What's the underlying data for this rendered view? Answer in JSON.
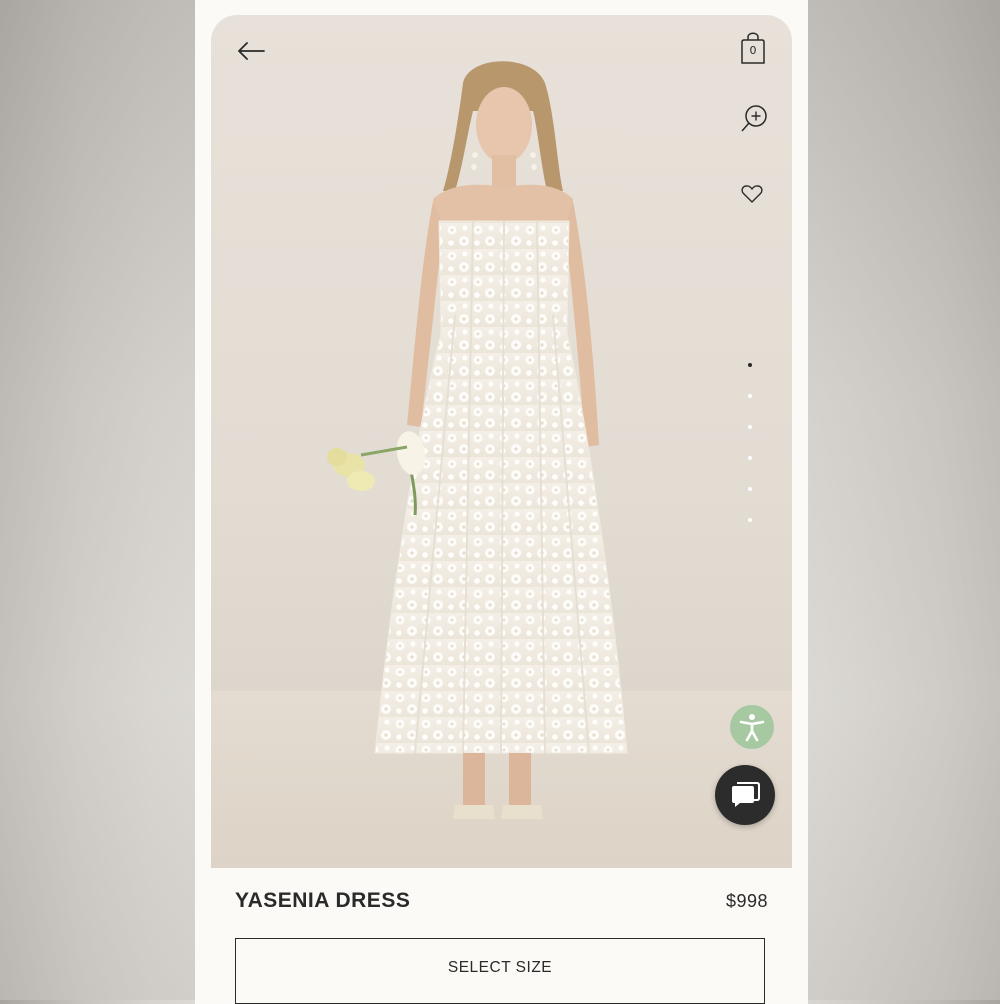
{
  "header": {
    "back_icon": "arrow-left-icon",
    "bag_icon": "shopping-bag-icon",
    "bag_count": "0",
    "zoom_icon": "zoom-in-icon",
    "wishlist_icon": "heart-icon"
  },
  "carousel": {
    "total_slides": 6,
    "active_index": 0
  },
  "floating": {
    "accessibility_icon": "accessibility-icon",
    "chat_icon": "chat-bubble-icon"
  },
  "product": {
    "name": "YASENIA DRESS",
    "price": "$998",
    "select_size_label": "SELECT SIZE"
  },
  "colors": {
    "text": "#2a2a2a",
    "background": "#fbfaf6",
    "accessibility_button": "#a7c9a2",
    "chat_button": "#2c2c2c"
  }
}
